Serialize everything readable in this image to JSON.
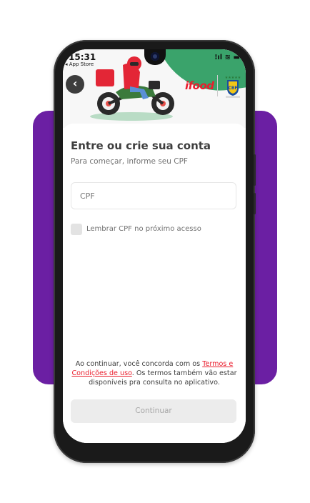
{
  "status_bar": {
    "time": "15:31",
    "back_to_app": "◂ App Store",
    "icons": "⁝ıl ≋ ▬"
  },
  "header": {
    "back_icon": "chevron-left-icon",
    "brand": "ifood",
    "partner_badge": "cbf-crest"
  },
  "login": {
    "title": "Entre ou crie sua conta",
    "subtitle": "Para começar, informe seu CPF",
    "cpf_placeholder": "CPF",
    "remember_label": "Lembrar CPF no próximo acesso",
    "terms_before": "Ao continuar, você concorda com os ",
    "terms_link": "Termos e Condições de uso",
    "terms_after": ". Os termos também vão estar disponíveis pra consulta no aplicativo.",
    "continue_label": "Continuar"
  },
  "colors": {
    "brand_red": "#ea1d2c",
    "purple_bg": "#6b1fa3",
    "disabled_button": "#ececec"
  }
}
